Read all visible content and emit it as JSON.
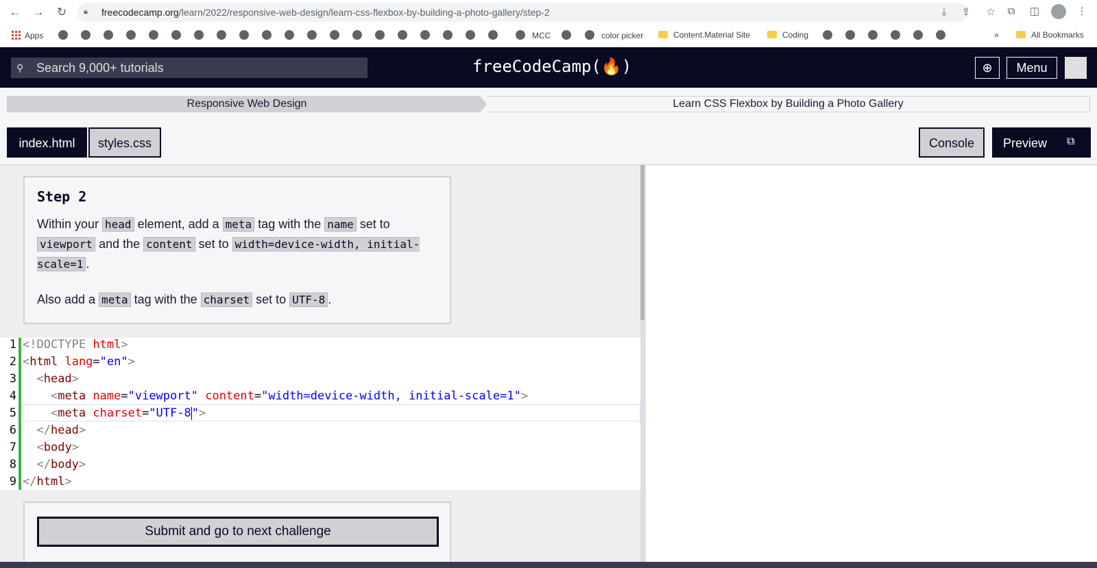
{
  "browser": {
    "url_domain": "freecodecamp.org",
    "url_path": "/learn/2022/responsive-web-design/learn-css-flexbox-by-building-a-photo-gallery/step-2",
    "icons": [
      "back-icon",
      "forward-icon",
      "reload-icon",
      "lock-icon",
      "install-icon",
      "share-icon",
      "star-icon",
      "extensions-icon",
      "sidepanel-icon",
      "profile-icon",
      "more-icon"
    ]
  },
  "bookmarks": {
    "apps": "Apps",
    "mcc": "MCC",
    "color_picker": "color picker",
    "content_material": "Content.Material Site",
    "coding": "Coding",
    "overflow": "»",
    "all": "All Bookmarks"
  },
  "header": {
    "search_placeholder": "Search 9,000+ tutorials",
    "logo": "freeCodeCamp(🔥)",
    "menu": "Menu"
  },
  "breadcrumb": {
    "superblock": "Responsive Web Design",
    "block": "Learn CSS Flexbox by Building a Photo Gallery"
  },
  "tabs": {
    "file1": "index.html",
    "file2": "styles.css",
    "console": "Console",
    "preview": "Preview"
  },
  "instructions": {
    "title": "Step 2",
    "p1": {
      "a": "Within your ",
      "c1": "head",
      "b": " element, add a ",
      "c2": "meta",
      "c": " tag with the ",
      "c3": "name",
      "d": " set to ",
      "c4": "viewport",
      "e": " and the ",
      "c5": "content",
      "f": " set to ",
      "c6": "width=device-width, initial-scale=1",
      "g": "."
    },
    "p2": {
      "a": "Also add a ",
      "c1": "meta",
      "b": " tag with the ",
      "c2": "charset",
      "c": " set to ",
      "c3": "UTF-8",
      "d": "."
    }
  },
  "editor": {
    "line_numbers": [
      "1",
      "2",
      "3",
      "4",
      "5",
      "6",
      "7",
      "8",
      "9"
    ]
  },
  "submit": {
    "label": "Submit and go to next challenge"
  }
}
